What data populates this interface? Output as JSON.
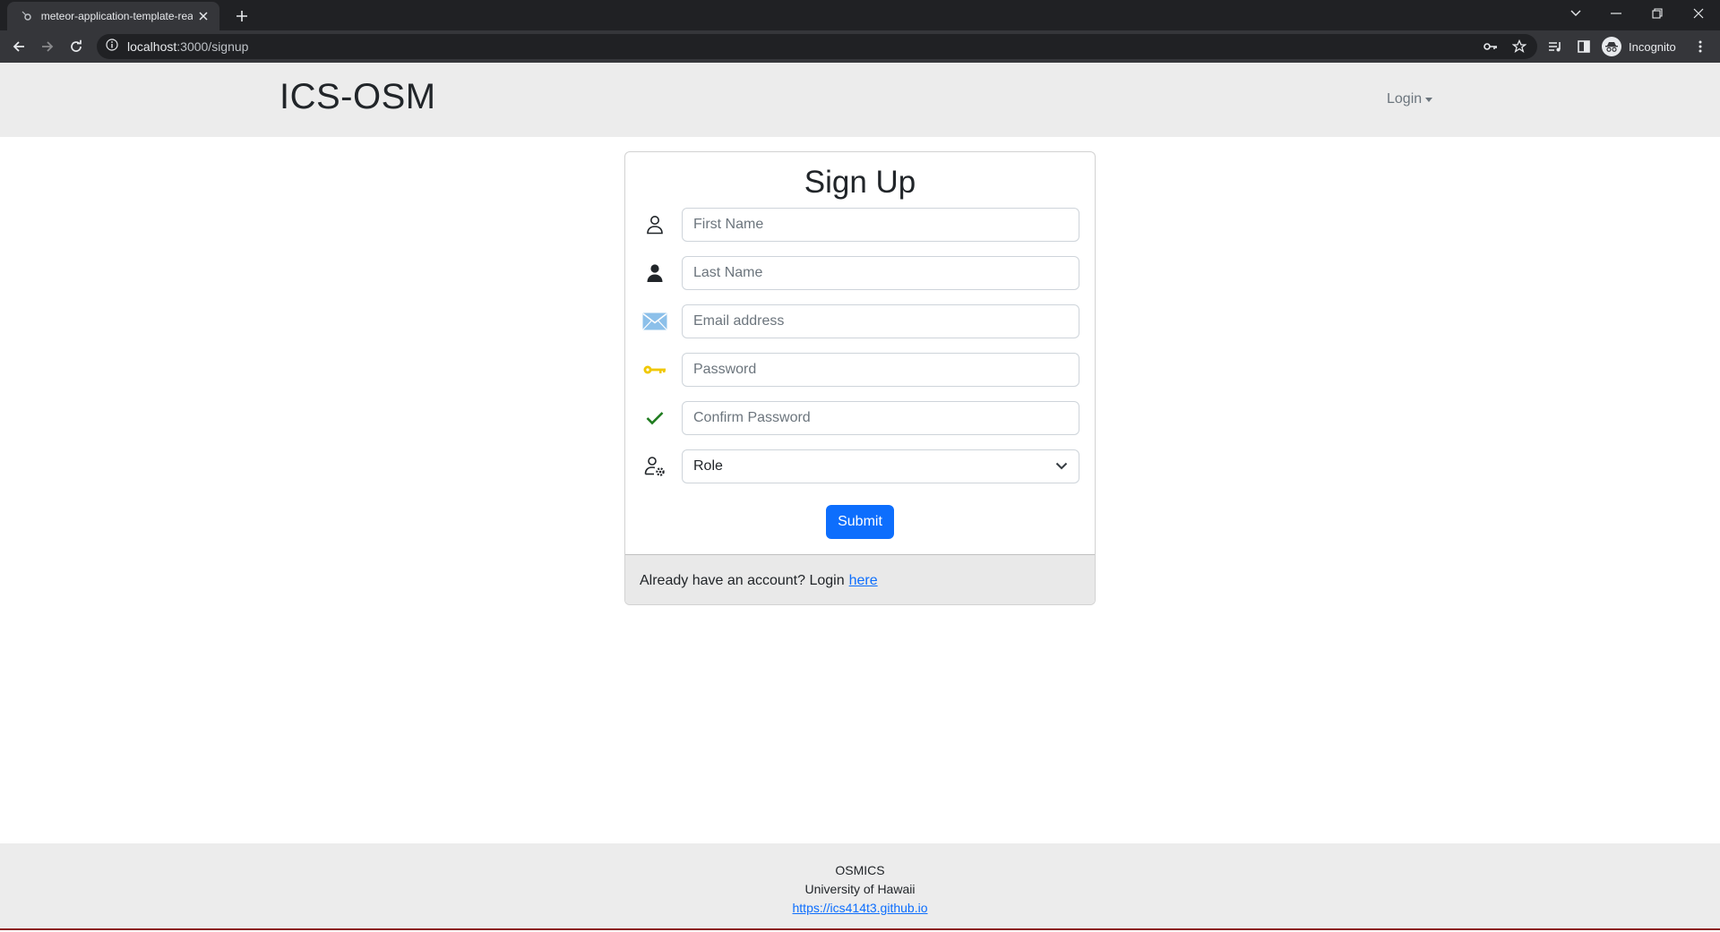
{
  "browser": {
    "tab_title": "meteor-application-template-rea",
    "url_host": "localhost",
    "url_path": ":3000/signup",
    "profile_label": "Incognito"
  },
  "navbar": {
    "brand": "ICS-OSM",
    "login_label": "Login"
  },
  "signup": {
    "title": "Sign Up",
    "fields": {
      "first_name": "First Name",
      "last_name": "Last Name",
      "email": "Email address",
      "password": "Password",
      "confirm_password": "Confirm Password",
      "role": "Role"
    },
    "icons": {
      "first_name": "person-outline-icon",
      "last_name": "person-filled-icon",
      "email": "envelope-icon",
      "password": "key-icon",
      "confirm_password": "checkmark-icon",
      "role": "person-gear-icon"
    },
    "submit_label": "Submit",
    "footer_text": "Already have an account? Login",
    "footer_link": "here"
  },
  "footer": {
    "line1": "OSMICS",
    "line2": "University of Hawaii",
    "link": "https://ics414t3.github.io"
  },
  "colors": {
    "primary": "#0d6efd",
    "navbar_bg": "#ececec",
    "key_icon": "#f0c800",
    "check_icon": "#1e7b1e",
    "envelope_icon": "#7fb6e6"
  }
}
